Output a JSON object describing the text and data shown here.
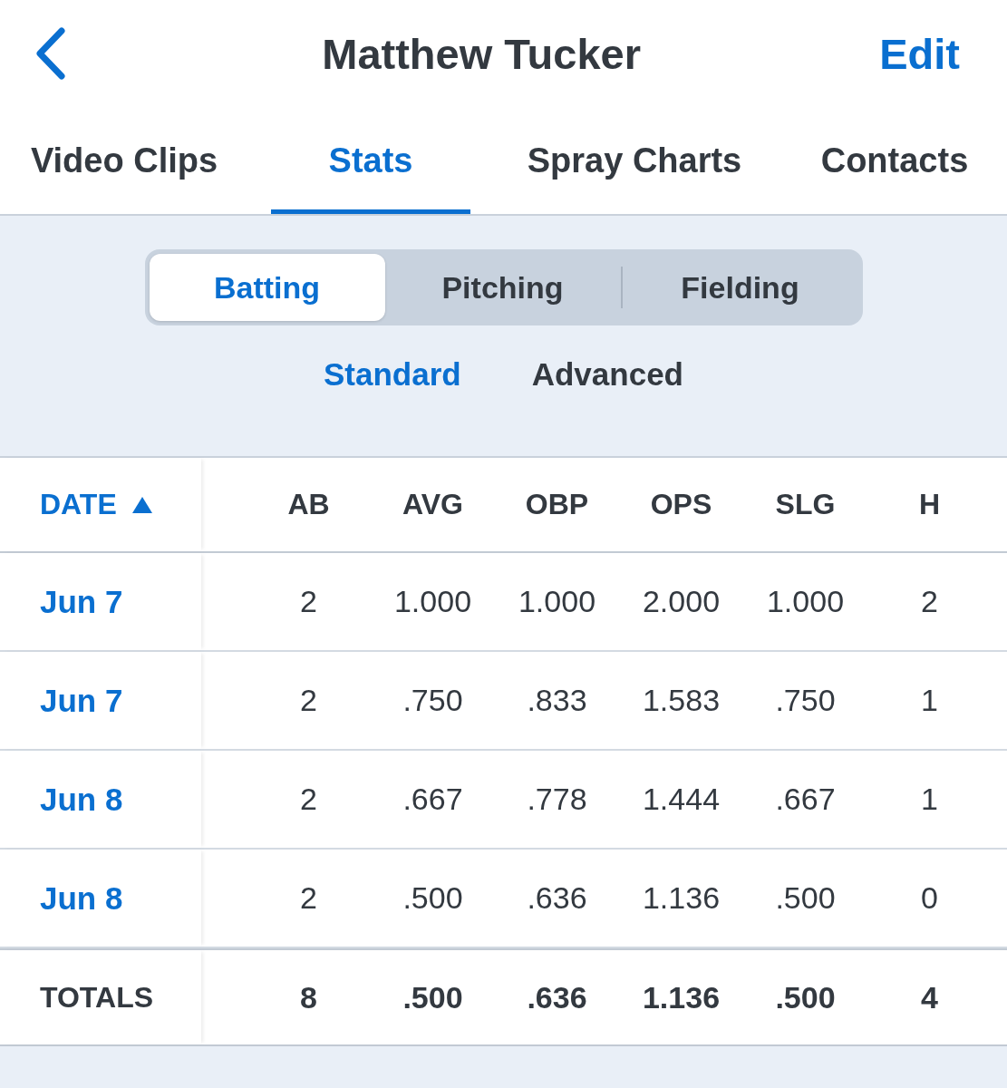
{
  "header": {
    "title": "Matthew Tucker",
    "action": "Edit"
  },
  "tabs": [
    {
      "label": "Video Clips",
      "selected": false
    },
    {
      "label": "Stats",
      "selected": true
    },
    {
      "label": "Spray Charts",
      "selected": false
    },
    {
      "label": "Contacts",
      "selected": false
    }
  ],
  "segments": [
    {
      "label": "Batting",
      "selected": true
    },
    {
      "label": "Pitching",
      "selected": false
    },
    {
      "label": "Fielding",
      "selected": false
    }
  ],
  "subtabs": [
    {
      "label": "Standard",
      "selected": true
    },
    {
      "label": "Advanced",
      "selected": false
    }
  ],
  "table": {
    "columns": [
      {
        "label": "DATE",
        "sorted": true
      },
      {
        "label": "AB",
        "sorted": false
      },
      {
        "label": "AVG",
        "sorted": false
      },
      {
        "label": "OBP",
        "sorted": false
      },
      {
        "label": "OPS",
        "sorted": false
      },
      {
        "label": "SLG",
        "sorted": false
      },
      {
        "label": "H",
        "sorted": false
      }
    ],
    "rows": [
      {
        "date": "Jun 7",
        "values": [
          "2",
          "1.000",
          "1.000",
          "2.000",
          "1.000",
          "2"
        ]
      },
      {
        "date": "Jun 7",
        "values": [
          "2",
          ".750",
          ".833",
          "1.583",
          ".750",
          "1"
        ]
      },
      {
        "date": "Jun 8",
        "values": [
          "2",
          ".667",
          ".778",
          "1.444",
          ".667",
          "1"
        ]
      },
      {
        "date": "Jun 8",
        "values": [
          "2",
          ".500",
          ".636",
          "1.136",
          ".500",
          "0"
        ]
      }
    ],
    "totals": {
      "label": "TOTALS",
      "values": [
        "8",
        ".500",
        ".636",
        "1.136",
        ".500",
        "4"
      ]
    }
  }
}
